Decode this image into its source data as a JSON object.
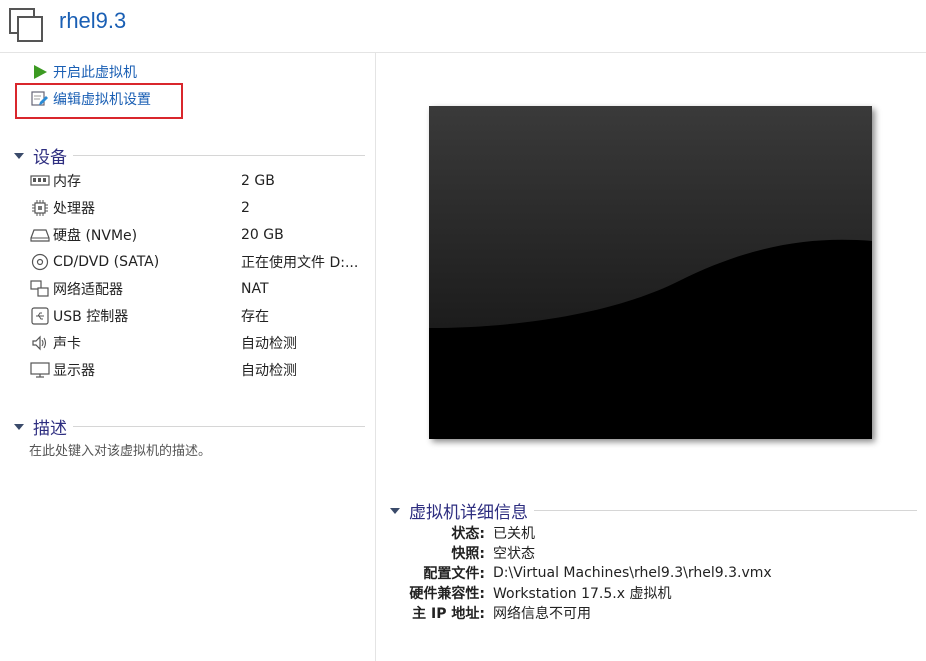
{
  "window": {
    "title": "rhel9.3"
  },
  "actions": {
    "power_on": "开启此虚拟机",
    "edit_settings": "编辑虚拟机设置"
  },
  "devices": {
    "title": "设备",
    "items": [
      {
        "name": "内存",
        "value": "2 GB",
        "icon": "memory-icon"
      },
      {
        "name": "处理器",
        "value": "2",
        "icon": "processor-icon"
      },
      {
        "name": "硬盘 (NVMe)",
        "value": "20 GB",
        "icon": "hard-disk-icon"
      },
      {
        "name": "CD/DVD (SATA)",
        "value": "正在使用文件 D:...",
        "icon": "cd-dvd-icon"
      },
      {
        "name": "网络适配器",
        "value": "NAT",
        "icon": "network-adapter-icon"
      },
      {
        "name": "USB 控制器",
        "value": "存在",
        "icon": "usb-icon"
      },
      {
        "name": "声卡",
        "value": "自动检测",
        "icon": "sound-card-icon"
      },
      {
        "name": "显示器",
        "value": "自动检测",
        "icon": "display-icon"
      }
    ]
  },
  "description": {
    "title": "描述",
    "placeholder": "在此处键入对该虚拟机的描述。"
  },
  "details": {
    "title": "虚拟机详细信息",
    "rows": [
      {
        "key": "状态:",
        "value": "已关机"
      },
      {
        "key": "快照:",
        "value": "空状态"
      },
      {
        "key": "配置文件:",
        "value": "D:\\Virtual Machines\\rhel9.3\\rhel9.3.vmx"
      },
      {
        "key": "硬件兼容性:",
        "value": "Workstation 17.5.x 虚拟机"
      },
      {
        "key": "主 IP 地址:",
        "value": "网络信息不可用"
      }
    ]
  },
  "colors": {
    "title": "#1a5fb4",
    "section": "#2e2e80",
    "highlight": "#d9262c"
  }
}
